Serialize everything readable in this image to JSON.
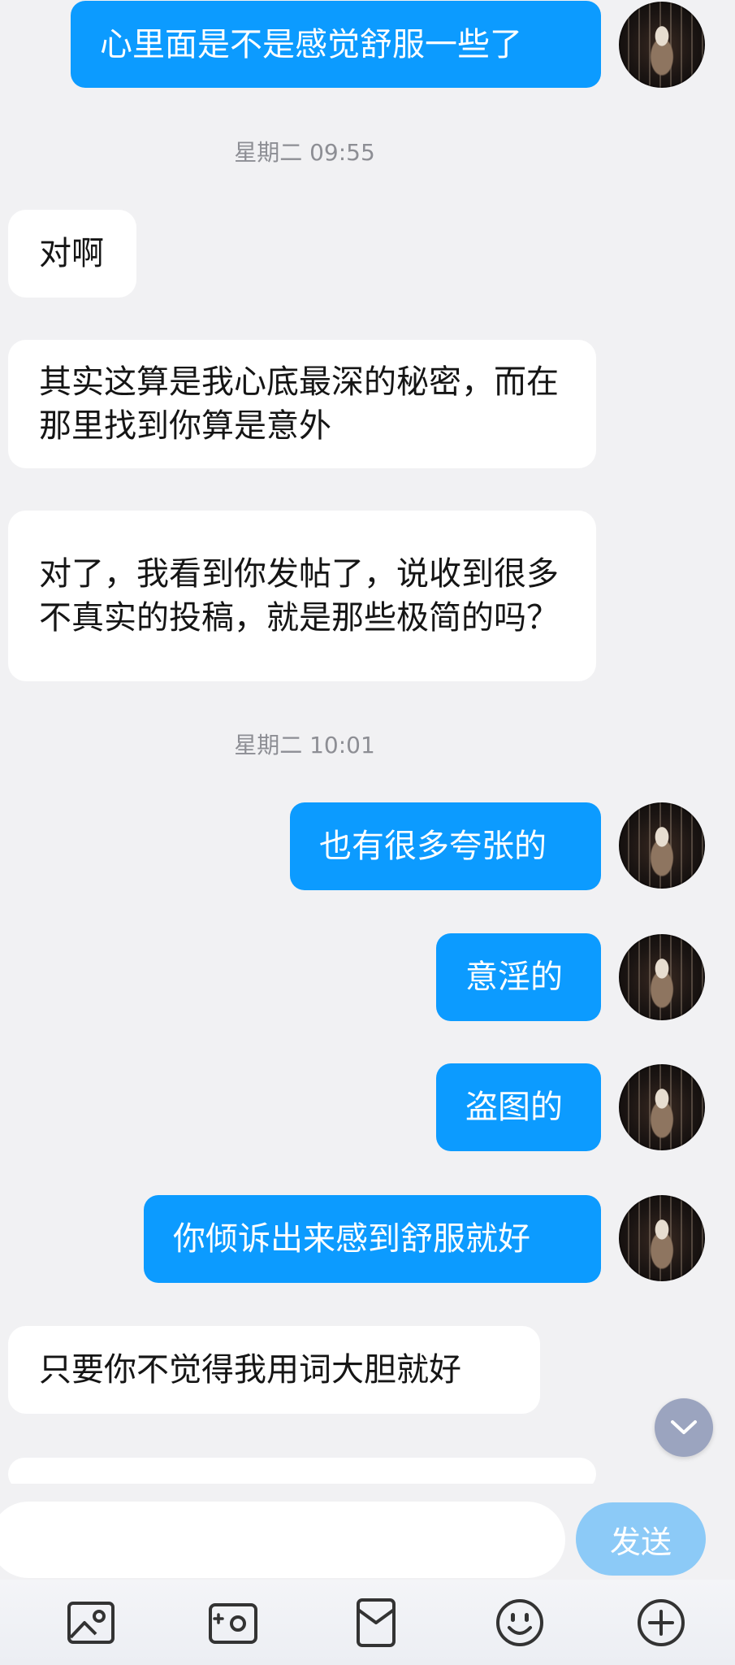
{
  "messages": [
    {
      "text": "心里面是不是感觉舒服一些了"
    },
    {
      "text": "对啊"
    },
    {
      "text": "其实这算是我心底最深的秘密，而在那里找到你算是意外"
    },
    {
      "text": "对了，我看到你发帖了，说收到很多不真实的投稿，就是那些极简的吗？"
    },
    {
      "text": "也有很多夸张的"
    },
    {
      "text": "意淫的"
    },
    {
      "text": "盗图的"
    },
    {
      "text": "你倾诉出来感到舒服就好"
    },
    {
      "text": "只要你不觉得我用词大胆就好"
    }
  ],
  "timestamps": [
    "星期二 09:55",
    "星期二 10:01"
  ],
  "composer": {
    "placeholder": "",
    "send_label": "发送"
  },
  "toolbar": {
    "icons": [
      "image-icon",
      "camera-icon",
      "red-packet-icon",
      "emoji-icon",
      "plus-icon"
    ]
  },
  "colors": {
    "outgoing_bubble": "#0c9bff",
    "incoming_bubble": "#ffffff",
    "send_button": "#8ccaf7",
    "background": "#f1f1f3"
  }
}
